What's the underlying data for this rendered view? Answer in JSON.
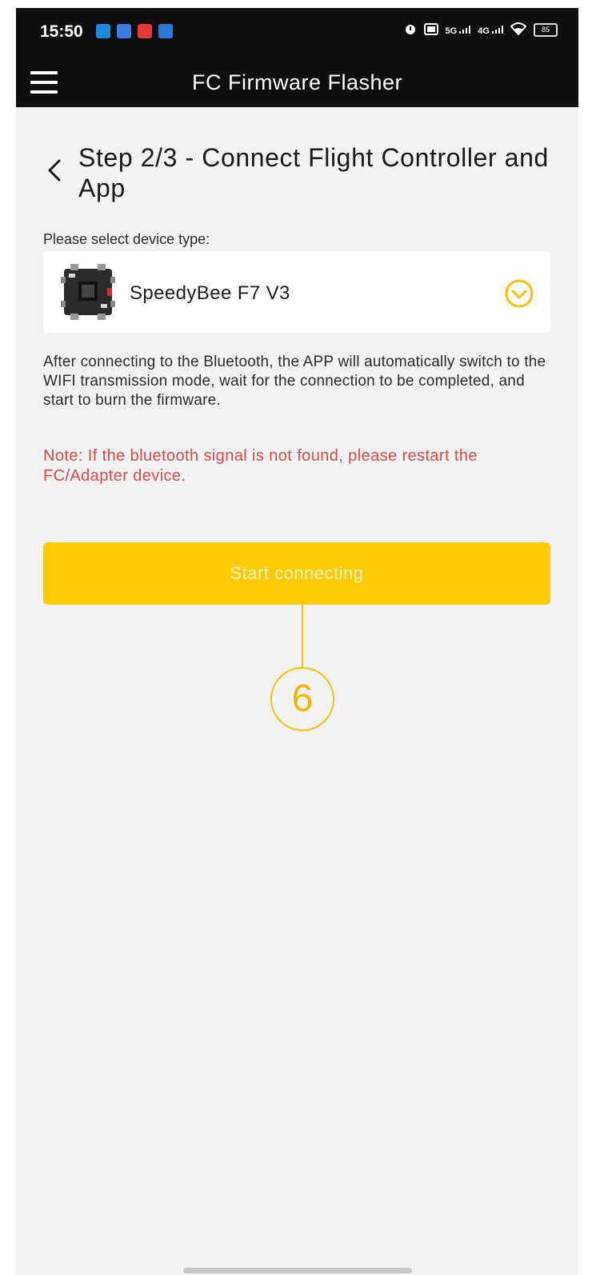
{
  "status_bar": {
    "time": "15:50",
    "signal_1": "5G",
    "signal_2": "4G",
    "battery": "85"
  },
  "app_bar": {
    "title": "FC Firmware Flasher"
  },
  "step": {
    "title": "Step 2/3 - Connect Flight Controller and App"
  },
  "device_select": {
    "label": "Please select device type:",
    "selected": "SpeedyBee F7 V3"
  },
  "info": {
    "text": "After connecting to the Bluetooth, the APP will automatically switch to the WIFI transmission mode, wait for the connection to be completed, and start to burn the firmware.",
    "note": "Note: If the bluetooth signal is not found, please restart the FC/Adapter device."
  },
  "actions": {
    "start_label": "Start connecting"
  },
  "callout": {
    "number": "6"
  },
  "colors": {
    "accent": "#fccb05",
    "note_red": "#d94a4a",
    "bar": "#0f0f0f"
  }
}
